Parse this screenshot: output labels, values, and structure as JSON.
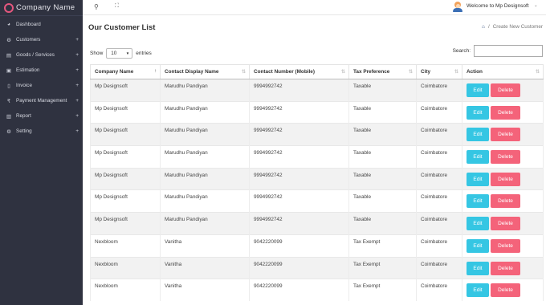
{
  "brand": {
    "name": "Company  Name"
  },
  "sidebar": {
    "items": [
      {
        "label": "Dashboard",
        "icon": "dashboard-icon",
        "glyph": "◕",
        "expandable": false
      },
      {
        "label": "Customers",
        "icon": "customers-icon",
        "glyph": "⚙",
        "expandable": true
      },
      {
        "label": "Goods / Services",
        "icon": "goods-icon",
        "glyph": "▤",
        "expandable": true
      },
      {
        "label": "Estimation",
        "icon": "estimation-icon",
        "glyph": "▣",
        "expandable": true
      },
      {
        "label": "Invoice",
        "icon": "invoice-icon",
        "glyph": "▯",
        "expandable": true
      },
      {
        "label": "Payment Management",
        "icon": "payment-icon",
        "glyph": "₹",
        "expandable": true
      },
      {
        "label": "Report",
        "icon": "report-icon",
        "glyph": "▥",
        "expandable": true
      },
      {
        "label": "Setting",
        "icon": "setting-icon",
        "glyph": "⚙",
        "expandable": true
      }
    ],
    "expand_symbol": "+"
  },
  "topbar": {
    "search_glyph": "⚲",
    "expand_glyph": "⛶",
    "welcome": "Welcome to Mp Designsoft",
    "caret": "⌄"
  },
  "page": {
    "title": "Our Customer List",
    "breadcrumb_home_glyph": "⌂",
    "breadcrumb_sep": "/",
    "breadcrumb_current": "Create New Customer"
  },
  "table_controls": {
    "show_label": "Show",
    "entries_value": "10",
    "entries_label": "entries",
    "search_label": "Search:",
    "search_value": ""
  },
  "table": {
    "headers": [
      "Company Name",
      "Contact Display Name",
      "Contact Number (Mobile)",
      "Tax Preference",
      "City",
      "Action"
    ],
    "sort_glyphs": [
      "↑",
      "⇅",
      "⇅",
      "⇅",
      "⇅",
      "⇅"
    ],
    "rows": [
      {
        "company": "Mp Designsoft",
        "contact": "Marudhu Pandiyan",
        "phone": "9994992742",
        "tax": "Taxable",
        "city": "Coimbatore"
      },
      {
        "company": "Mp Designsoft",
        "contact": "Marudhu Pandiyan",
        "phone": "9994992742",
        "tax": "Taxable",
        "city": "Coimbatore"
      },
      {
        "company": "Mp Designsoft",
        "contact": "Marudhu Pandiyan",
        "phone": "9994992742",
        "tax": "Taxable",
        "city": "Coimbatore"
      },
      {
        "company": "Mp Designsoft",
        "contact": "Marudhu Pandiyan",
        "phone": "9994992742",
        "tax": "Taxable",
        "city": "Coimbatore"
      },
      {
        "company": "Mp Designsoft",
        "contact": "Marudhu Pandiyan",
        "phone": "9994992742",
        "tax": "Taxable",
        "city": "Coimbatore"
      },
      {
        "company": "Mp Designsoft",
        "contact": "Marudhu Pandiyan",
        "phone": "9994992742",
        "tax": "Taxable",
        "city": "Coimbatore"
      },
      {
        "company": "Mp Designsoft",
        "contact": "Marudhu Pandiyan",
        "phone": "9994992742",
        "tax": "Taxable",
        "city": "Coimbatore"
      },
      {
        "company": "Nexbloom",
        "contact": "Vanitha",
        "phone": "9042220099",
        "tax": "Tax Exempt",
        "city": "Coimbatore"
      },
      {
        "company": "Nexbloom",
        "contact": "Vanitha",
        "phone": "9042220099",
        "tax": "Tax Exempt",
        "city": "Coimbatore"
      },
      {
        "company": "Nexbloom",
        "contact": "Vanitha",
        "phone": "9042220099",
        "tax": "Tax Exempt",
        "city": "Coimbatore"
      }
    ],
    "edit_label": "Edit",
    "delete_label": "Delete"
  },
  "colors": {
    "sidebar_bg": "#2f3240",
    "logo_ring": "#e4577e",
    "edit_button": "#35c6e3",
    "delete_button": "#f4637a"
  }
}
